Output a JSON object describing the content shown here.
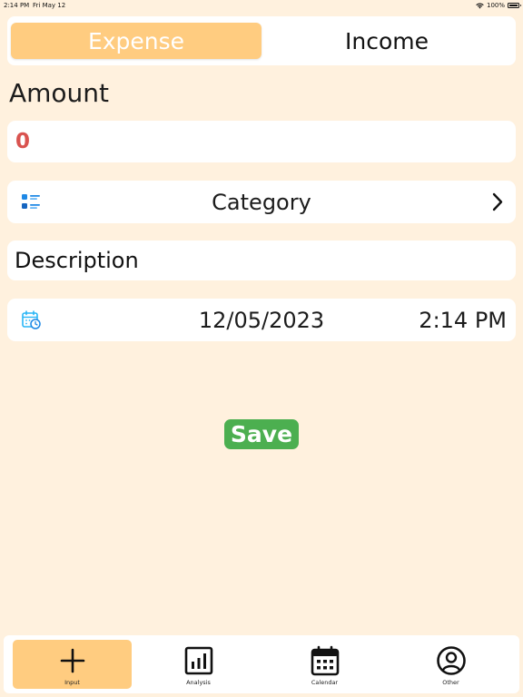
{
  "status_bar": {
    "time": "2:14 PM",
    "date": "Fri May 12",
    "battery": "100%"
  },
  "segmented": {
    "expense_label": "Expense",
    "income_label": "Income",
    "selected": "Expense"
  },
  "amount": {
    "heading": "Amount",
    "value": "0"
  },
  "category": {
    "label": "Category",
    "icon": "list-icon"
  },
  "description": {
    "placeholder": "Description"
  },
  "datetime": {
    "date": "12/05/2023",
    "time": "2:14 PM",
    "icon": "calendar-clock-icon"
  },
  "save_label": "Save",
  "tabs": [
    {
      "label": "Input",
      "icon": "plus-icon",
      "active": true
    },
    {
      "label": "Analysis",
      "icon": "bar-chart-icon",
      "active": false
    },
    {
      "label": "Calendar",
      "icon": "calendar-icon",
      "active": false
    },
    {
      "label": "Other",
      "icon": "person-circle-icon",
      "active": false
    }
  ],
  "colors": {
    "background": "#FFF1DE",
    "accent": "#FFCC80",
    "save": "#4CAF50",
    "amount": "#D9534F",
    "icon_blue": "#1E88E5"
  }
}
